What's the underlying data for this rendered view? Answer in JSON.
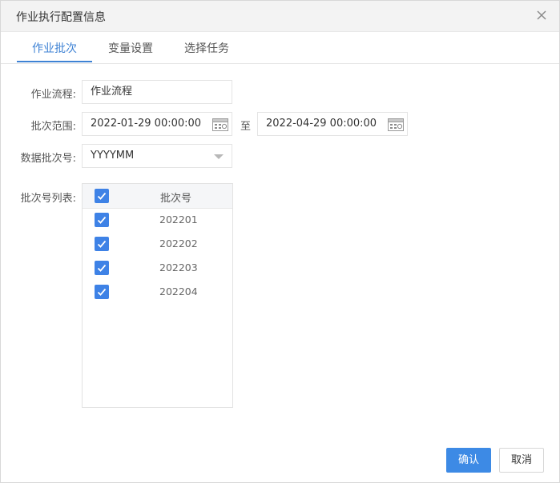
{
  "dialog": {
    "title": "作业执行配置信息",
    "close_icon": "close-icon"
  },
  "tabs": [
    {
      "label": "作业批次",
      "active": true
    },
    {
      "label": "变量设置",
      "active": false
    },
    {
      "label": "选择任务",
      "active": false
    }
  ],
  "form": {
    "workflow": {
      "label": "作业流程:",
      "value": "作业流程"
    },
    "batch_range": {
      "label": "批次范围:",
      "start": "2022-01-29 00:00:00",
      "separator": "至",
      "end": "2022-04-29 00:00:00",
      "icon": "calendar-icon"
    },
    "data_batch": {
      "label": "数据批次号:",
      "value": "YYYYMM",
      "icon": "chevron-down-icon"
    },
    "batch_list": {
      "label": "批次号列表:",
      "header": "批次号",
      "header_checked": true,
      "rows": [
        {
          "value": "202201",
          "checked": true
        },
        {
          "value": "202202",
          "checked": true
        },
        {
          "value": "202203",
          "checked": true
        },
        {
          "value": "202204",
          "checked": true
        }
      ]
    }
  },
  "buttons": {
    "confirm": "确认",
    "cancel": "取消"
  },
  "colors": {
    "accent": "#3e82d4",
    "checkbox": "#3e82e6",
    "primary_button": "#3d8ae5"
  }
}
